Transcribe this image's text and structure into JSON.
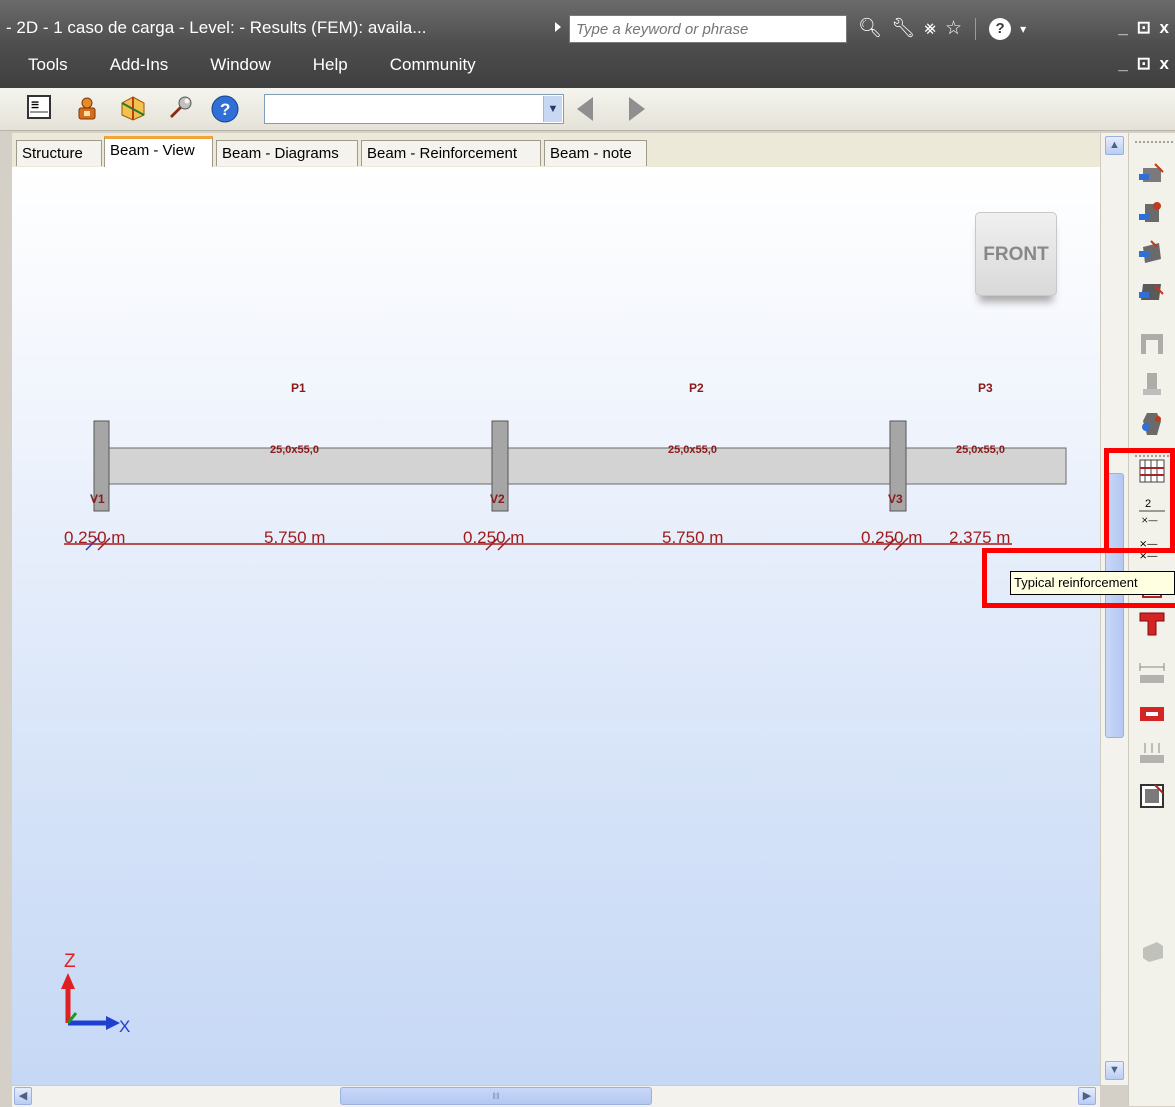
{
  "window": {
    "title": "- 2D - 1 caso de carga - Level:  - Results (FEM): availa...",
    "controls_top": "_ ⊡ x",
    "controls_menu": "_ ⊡ x"
  },
  "search": {
    "placeholder": "Type a keyword or phrase"
  },
  "title_icons": [
    "binoculars-icon",
    "wrench-icon",
    "satellite-icon",
    "star-icon",
    "help-icon"
  ],
  "menu": {
    "items": [
      "Tools",
      "Add-Ins",
      "Window",
      "Help",
      "Community"
    ]
  },
  "toolbar": {
    "icons": [
      "grid-icon",
      "lock-person-icon",
      "cube-axes-icon",
      "wrench-icon",
      "help-icon"
    ],
    "combo_value": ""
  },
  "tabs": [
    {
      "label": "Structure"
    },
    {
      "label": "Beam - View"
    },
    {
      "label": "Beam - Diagrams"
    },
    {
      "label": "Beam - Reinforcement"
    },
    {
      "label": "Beam - note"
    }
  ],
  "active_tab": "Beam - View",
  "viewcube": {
    "face": "FRONT"
  },
  "beam": {
    "spans": [
      {
        "name": "P1",
        "section": "25,0x55,0"
      },
      {
        "name": "P2",
        "section": "25,0x55,0"
      },
      {
        "name": "P3",
        "section": "25,0x55,0"
      }
    ],
    "supports": [
      "V1",
      "V2",
      "V3"
    ],
    "dimensions": [
      "0.250 m",
      "5.750 m",
      "0.250 m",
      "5.750 m",
      "0.250 m",
      "2.375 m"
    ]
  },
  "axes": {
    "z": "Z",
    "x": "X"
  },
  "tooltip": {
    "text": "Typical reinforcement"
  },
  "colors": {
    "title_bg": "#4e4e4e",
    "beam_fill": "#d3d3d3",
    "beam_text": "#8b1a1a",
    "dimension_line": "#a01c1c",
    "highlight": "#ff0000",
    "axis_z": "#e02020",
    "axis_x": "#1f3fcf",
    "tab_accent": "#f3a43b"
  }
}
